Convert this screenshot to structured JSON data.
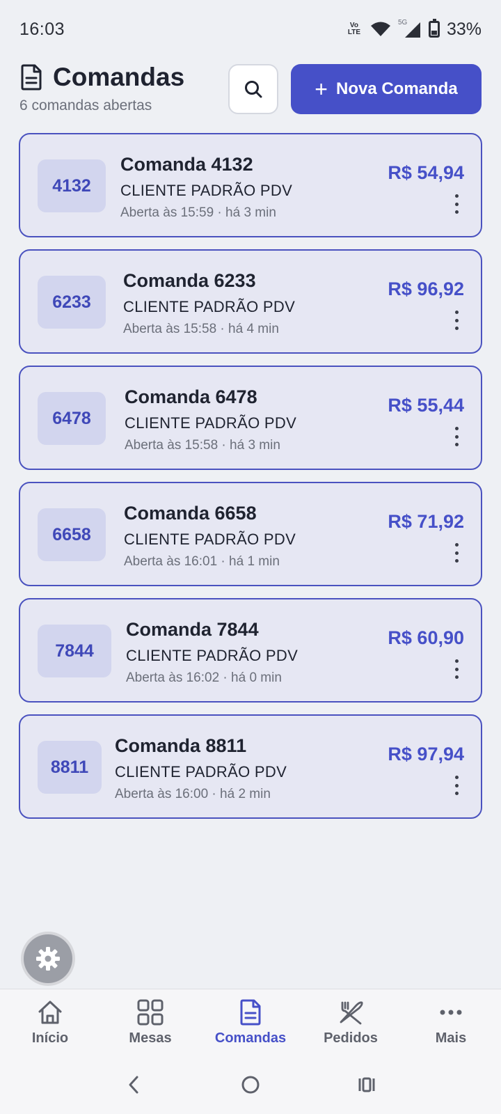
{
  "status_bar": {
    "time": "16:03",
    "network_label": "Vo)) LTE",
    "signal_label": "5G",
    "battery": "33%"
  },
  "header": {
    "title": "Comandas",
    "subtitle": "6 comandas abertas",
    "new_button_label": "Nova Comanda"
  },
  "orders": [
    {
      "number": "4132",
      "title": "Comanda 4132",
      "client": "CLIENTE PADRÃO PDV",
      "opened": "Aberta às 15:59 · há 3 min",
      "amount": "R$ 54,94"
    },
    {
      "number": "6233",
      "title": "Comanda 6233",
      "client": "CLIENTE PADRÃO PDV",
      "opened": "Aberta às 15:58 · há 4 min",
      "amount": "R$ 96,92"
    },
    {
      "number": "6478",
      "title": "Comanda 6478",
      "client": "CLIENTE PADRÃO PDV",
      "opened": "Aberta às 15:58 · há 3 min",
      "amount": "R$ 55,44"
    },
    {
      "number": "6658",
      "title": "Comanda 6658",
      "client": "CLIENTE PADRÃO PDV",
      "opened": "Aberta às 16:01 · há 1 min",
      "amount": "R$ 71,92"
    },
    {
      "number": "7844",
      "title": "Comanda 7844",
      "client": "CLIENTE PADRÃO PDV",
      "opened": "Aberta às 16:02 · há 0 min",
      "amount": "R$ 60,90"
    },
    {
      "number": "8811",
      "title": "Comanda 8811",
      "client": "CLIENTE PADRÃO PDV",
      "opened": "Aberta às 16:00 · há 2 min",
      "amount": "R$ 97,94"
    }
  ],
  "bottom_nav": {
    "items": [
      {
        "label": "Início",
        "icon": "home-icon"
      },
      {
        "label": "Mesas",
        "icon": "grid-icon"
      },
      {
        "label": "Comandas",
        "icon": "document-icon",
        "active": true
      },
      {
        "label": "Pedidos",
        "icon": "utensils-icon"
      },
      {
        "label": "Mais",
        "icon": "more-icon"
      }
    ]
  },
  "colors": {
    "accent": "#4650c8",
    "card_bg": "#e6e7f3",
    "card_border": "#4a52bf",
    "page_bg": "#eef0f4"
  }
}
